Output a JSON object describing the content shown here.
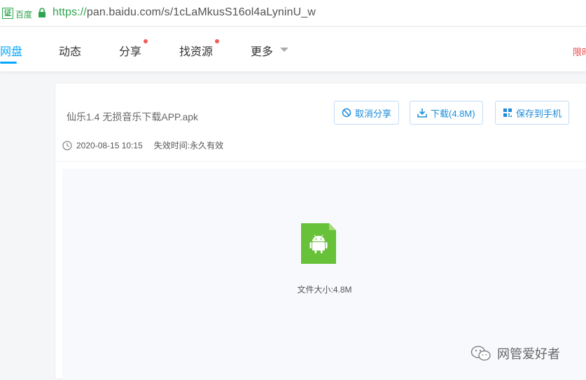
{
  "addressbar": {
    "cert_glyph": "证",
    "cert_name": "百度",
    "url_scheme": "https://",
    "url_rest": "pan.baidu.com/s/1cLaMkusS16ol4aLyninU_w"
  },
  "nav": {
    "items": [
      {
        "label": "网盘",
        "active": true
      },
      {
        "label": "动态"
      },
      {
        "label": "分享",
        "dot": true
      },
      {
        "label": "找资源",
        "dot": true
      },
      {
        "label": "更多"
      }
    ],
    "right_text": "限时"
  },
  "share": {
    "file_name": "仙乐1.4 无损音乐下载APP.apk",
    "buttons": {
      "cancel_share": "取消分享",
      "download": "下载(4.8M)",
      "save_to_phone": "保存到手机"
    },
    "date": "2020-08-15 10:15",
    "expire_label": "失效时间:",
    "expire_value": "永久有效",
    "file_size_text": "文件大小:4.8M"
  },
  "watermark": {
    "text": "网管爱好者"
  },
  "colors": {
    "accent": "#06a7ff",
    "link": "#1c8cdb",
    "android_green": "#67c23a",
    "dot_red": "#f25c5c"
  }
}
